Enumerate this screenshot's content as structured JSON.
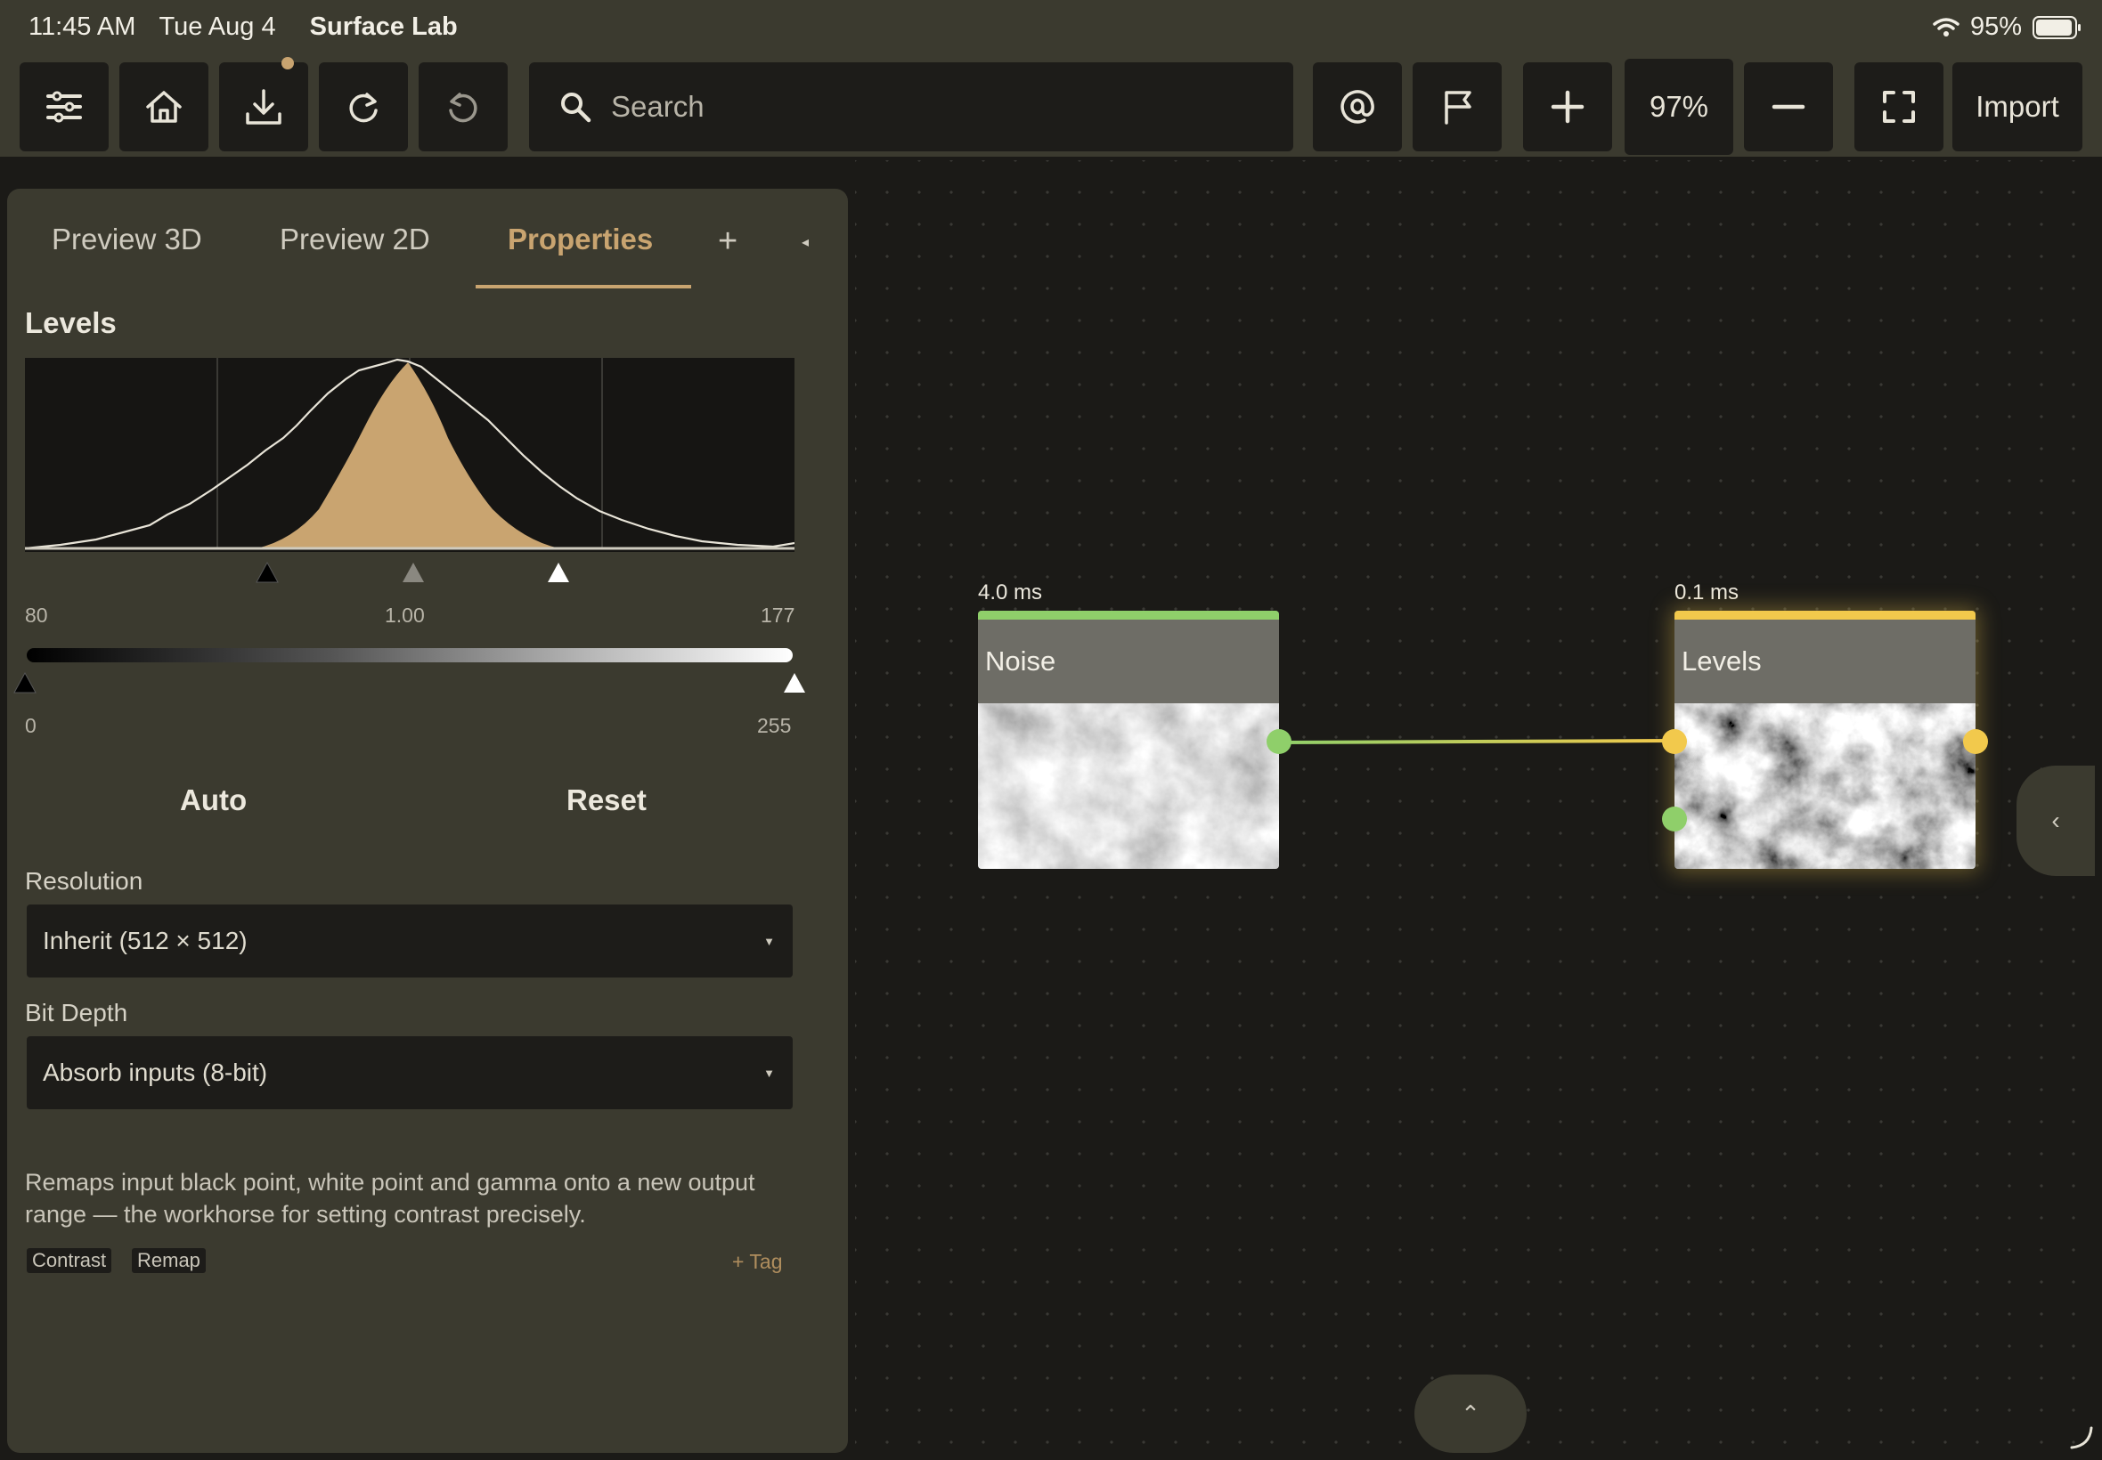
{
  "status": {
    "time": "11:45 AM",
    "date": "Tue Aug 4",
    "app_name": "Surface Lab",
    "battery": "95%"
  },
  "toolbar": {
    "search_placeholder": "Search",
    "zoom": "97%",
    "import_label": "Import",
    "icons": [
      "sliders-icon",
      "home-icon",
      "download-icon",
      "redo-icon",
      "undo-icon",
      "at-icon",
      "flag-icon",
      "plus-icon",
      "minus-icon",
      "fullscreen-icon"
    ]
  },
  "panel": {
    "tabs": [
      "Preview 3D",
      "Preview 2D",
      "Properties"
    ],
    "active_tab": "Properties",
    "add_tab": "+",
    "collapse": "◂",
    "section_title": "Levels",
    "levels": {
      "input_low": "80",
      "gamma": "1.00",
      "input_high": "177",
      "output_low": "0",
      "output_high": "255"
    },
    "auto_label": "Auto",
    "reset_label": "Reset",
    "resolution": {
      "label": "Resolution",
      "value": "Inherit (512 × 512)"
    },
    "bit_depth": {
      "label": "Bit Depth",
      "value": "Absorb inputs (8-bit)"
    },
    "description": "Remaps input black point, white point and gamma onto a new output range — the workhorse for setting contrast precisely.",
    "tags": [
      "Contrast",
      "Remap"
    ],
    "add_tag": "+ Tag"
  },
  "graph": {
    "nodes": [
      {
        "title": "Noise",
        "time": "4.0 ms",
        "color": "#8fcf6a"
      },
      {
        "title": "Levels",
        "time": "0.1 ms",
        "color": "#f2c94c"
      }
    ]
  },
  "colors": {
    "accent": "#c9a470",
    "toolbar": "#3b3a2f",
    "canvas": "#1b1a17"
  }
}
